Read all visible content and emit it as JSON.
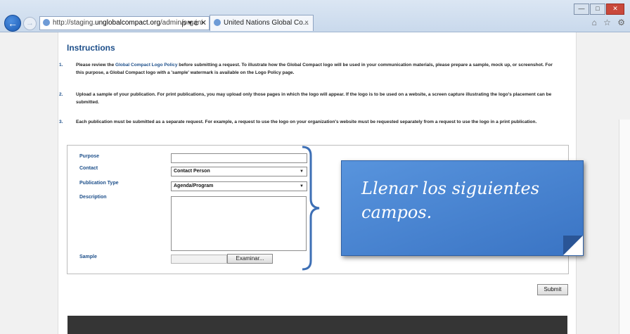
{
  "browser": {
    "url_prefix": "http://staging.",
    "url_domain": "unglobalcompact.org",
    "url_path": "/admin/organi",
    "url_tools": "ρ ▾ ċ ✕",
    "tab_title": "United Nations Global Co...",
    "tab_close": "×",
    "back_glyph": "←",
    "forward_glyph": "→",
    "window_controls": [
      "—",
      "□",
      "✕"
    ],
    "home_icons": "⌂ ☆ ⚙"
  },
  "page": {
    "section_title": "Instructions",
    "instructions": [
      {
        "number": "1.",
        "before": "Please review the ",
        "link": "Global Compact Logo Policy",
        "after": " before submitting a request. To illustrate how the Global Compact logo will be used in your communication materials, please prepare a sample, mock up, or screenshot. For this purpose, a Global Compact logo with a 'sample' watermark is available on the Logo Policy page."
      },
      {
        "number": "2.",
        "before": "Upload a sample of your publication. For print publications, you may upload only those pages in which the logo will appear. If the logo is to be used on a website, a screen capture illustrating the logo's placement can be submitted.",
        "link": "",
        "after": ""
      },
      {
        "number": "3.",
        "before": "Each publication must be submitted as a separate request. For example, a request to use the logo on your organization's website must be requested separately from a request to use the logo in a print publication.",
        "link": "",
        "after": ""
      }
    ]
  },
  "form": {
    "purpose_label": "Purpose",
    "purpose_value": "",
    "contact_label": "Contact",
    "contact_value": "Contact Person",
    "publication_type_label": "Publication Type",
    "publication_type_value": "Agenda/Program",
    "description_label": "Description",
    "description_value": "",
    "sample_label": "Sample",
    "browse_label": "Examinar...",
    "submit_label": "Submit",
    "dropdown_arrow": "▼"
  },
  "callout": {
    "text": "Llenar los siguientes campos."
  },
  "colors": {
    "accent": "#1d4f8a",
    "callout_bg": "#4a86d3",
    "footer": "#353535"
  }
}
